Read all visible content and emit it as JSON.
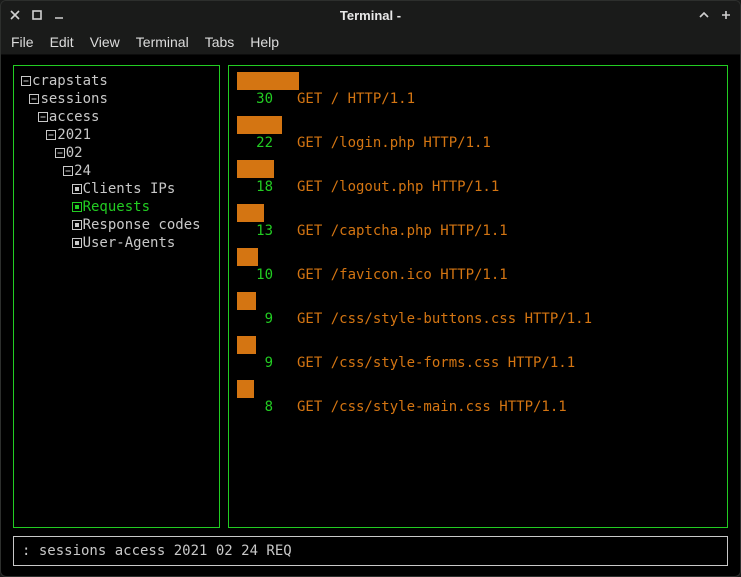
{
  "window": {
    "title": "Terminal -"
  },
  "menubar": [
    "File",
    "Edit",
    "View",
    "Terminal",
    "Tabs",
    "Help"
  ],
  "tree": [
    {
      "level": 0,
      "kind": "expand",
      "label": "crapstats"
    },
    {
      "level": 1,
      "kind": "expand",
      "label": "sessions"
    },
    {
      "level": 2,
      "kind": "expand",
      "label": "access"
    },
    {
      "level": 3,
      "kind": "expand",
      "label": "2021"
    },
    {
      "level": 4,
      "kind": "expand",
      "label": "02"
    },
    {
      "level": 5,
      "kind": "expand",
      "label": "24"
    },
    {
      "level": 6,
      "kind": "leaf",
      "label": "Clients IPs"
    },
    {
      "level": 6,
      "kind": "leaf",
      "label": "Requests",
      "selected": true
    },
    {
      "level": 6,
      "kind": "leaf",
      "label": "Response codes"
    },
    {
      "level": 6,
      "kind": "leaf",
      "label": "User-Agents"
    }
  ],
  "chart_data": {
    "type": "bar",
    "title": "",
    "xlabel": "",
    "ylabel": "",
    "categories": [
      "GET / HTTP/1.1",
      "GET /login.php HTTP/1.1",
      "GET /logout.php HTTP/1.1",
      "GET /captcha.php HTTP/1.1",
      "GET /favicon.ico HTTP/1.1",
      "GET /css/style-buttons.css HTTP/1.1",
      "GET /css/style-forms.css HTTP/1.1",
      "GET /css/style-main.css HTTP/1.1"
    ],
    "values": [
      30,
      22,
      18,
      13,
      10,
      9,
      9,
      8
    ],
    "ylim": [
      0,
      30
    ]
  },
  "status": ": sessions access 2021 02 24 REQ",
  "colors": {
    "bar": "#d47512",
    "green": "#22cc22",
    "border": "#22cc22",
    "text": "#c8c8c8"
  }
}
